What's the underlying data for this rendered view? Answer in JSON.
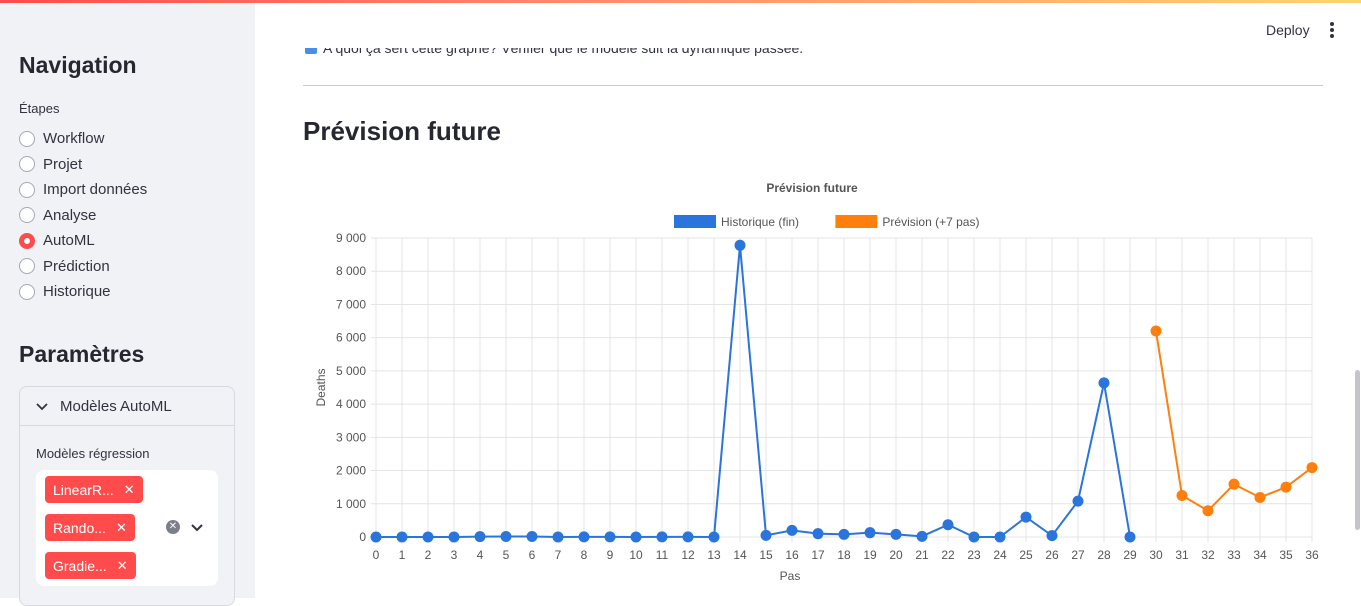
{
  "sidebar": {
    "nav_title": "Navigation",
    "etapes_label": "Étapes",
    "steps": [
      {
        "label": "Workflow",
        "checked": false
      },
      {
        "label": "Projet",
        "checked": false
      },
      {
        "label": "Import données",
        "checked": false
      },
      {
        "label": "Analyse",
        "checked": false
      },
      {
        "label": "AutoML",
        "checked": true
      },
      {
        "label": "Prédiction",
        "checked": false
      },
      {
        "label": "Historique",
        "checked": false
      }
    ],
    "params_title": "Paramètres",
    "expander_label": "Modèles AutoML",
    "regression_label": "Modèles régression",
    "selected_models": [
      "LinearR...",
      "Rando...",
      "Gradie..."
    ],
    "accent_color": "#ff4b4b"
  },
  "header": {
    "deploy_label": "Deploy"
  },
  "main": {
    "cut_text": "A quoi ça sert cette graphe? Vérifier que le modèle suit la dynamique passée.",
    "section_title": "Prévision future"
  },
  "chart_data": {
    "type": "line",
    "title": "Prévision future",
    "xlabel": "Pas",
    "ylabel": "Deaths",
    "ylim": [
      0,
      9000
    ],
    "yticks": [
      "0",
      "1 000",
      "2 000",
      "3 000",
      "4 000",
      "5 000",
      "6 000",
      "7 000",
      "8 000",
      "9 000"
    ],
    "grid": true,
    "legend_position": "top",
    "series": [
      {
        "name": "Historique (fin)",
        "color": "#2a74db",
        "x": [
          0,
          1,
          2,
          3,
          4,
          5,
          6,
          7,
          8,
          9,
          10,
          11,
          12,
          13,
          14,
          15,
          16,
          17,
          18,
          19,
          20,
          21,
          22,
          23,
          24,
          25,
          26,
          27,
          28,
          29
        ],
        "values": [
          0,
          0,
          0,
          0,
          10,
          15,
          15,
          0,
          5,
          5,
          0,
          5,
          5,
          0,
          8780,
          50,
          200,
          100,
          80,
          130,
          80,
          20,
          370,
          0,
          0,
          600,
          40,
          1080,
          4640,
          0
        ]
      },
      {
        "name": "Prévision (+7 pas)",
        "color": "#ff7f0e",
        "x": [
          30,
          31,
          32,
          33,
          34,
          35,
          36
        ],
        "values": [
          6200,
          1250,
          790,
          1590,
          1190,
          1500,
          2090
        ]
      }
    ]
  }
}
